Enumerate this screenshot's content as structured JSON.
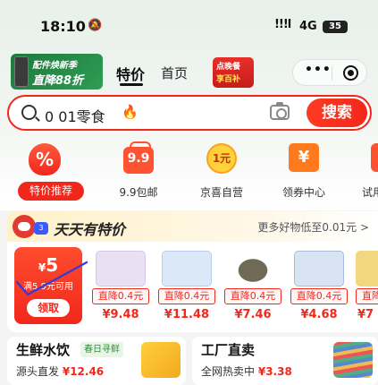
{
  "status_bar": {
    "time": "18:10",
    "bell": "🔕",
    "signal": "!!!l",
    "network": "4G",
    "battery": "35"
  },
  "header": {
    "promo_badge": {
      "line1": "配件焕新季",
      "line2": "直降88折"
    },
    "tabs": [
      {
        "label": "特价",
        "active": true
      },
      {
        "label": "首页",
        "active": false
      }
    ],
    "mini_badge": {
      "line1": "点晚餐",
      "line2": "享百补"
    },
    "capsule": {
      "more_icon": "•••",
      "close_icon": "target-circle"
    }
  },
  "search": {
    "query": "0 01零食",
    "fire_icon": "🔥",
    "button_label": "搜索"
  },
  "categories": [
    {
      "label": "特价推荐",
      "icon": "%",
      "active": true
    },
    {
      "label": "9.9包邮",
      "icon": "9.9",
      "active": false
    },
    {
      "label": "京喜自营",
      "icon": "1元",
      "active": false
    },
    {
      "label": "领券中心",
      "icon": "¥",
      "active": false
    },
    {
      "label": "试用",
      "icon": "",
      "active": false
    }
  ],
  "deals": {
    "title": "天天有特价",
    "more": "更多好物低至0.01元 >",
    "coupon": {
      "currency": "¥",
      "amount": "5",
      "condition": "满5.9元可用",
      "button": "领取"
    },
    "products": [
      {
        "tag": "直降0.4元",
        "price": "¥9.48",
        "color": "#e9e1f3"
      },
      {
        "tag": "直降0.4元",
        "price": "¥11.48",
        "color": "#dbe8f7"
      },
      {
        "tag": "直降0.4元",
        "price": "¥7.46",
        "color": "#6e6a55"
      },
      {
        "tag": "直降0.4元",
        "price": "¥4.68",
        "color": "#d9e4f2"
      },
      {
        "tag": "直降",
        "price": "¥7",
        "color": "#f3d780"
      }
    ]
  },
  "bottom_cards": [
    {
      "title": "生鲜水饮",
      "tag": "春日寻鲜",
      "sub_text": "源头直发",
      "price": "¥12.46"
    },
    {
      "title": "工厂直卖",
      "tag": "",
      "sub_text": "全网热卖中",
      "price": "¥3.38"
    }
  ],
  "colors": {
    "accent": "#f2271c",
    "header_bg": "#e7f0ea",
    "promo_green": "#1b7a3d"
  }
}
